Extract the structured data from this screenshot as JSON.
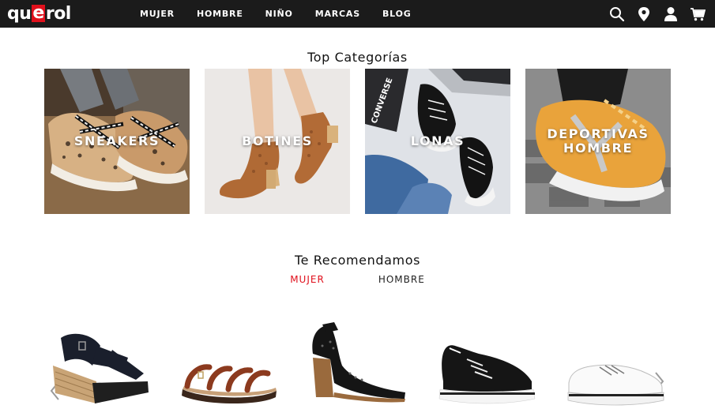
{
  "brand": {
    "logo_left": "qu",
    "logo_mid": "e",
    "logo_right": "rol",
    "accent": "#e0101c"
  },
  "nav": {
    "items": [
      "MUJER",
      "HOMBRE",
      "NIÑO",
      "MARCAS",
      "BLOG"
    ]
  },
  "header_icons": [
    "search-icon",
    "location-pin-icon",
    "user-icon",
    "cart-icon"
  ],
  "top_categories": {
    "title": "Top Categorías",
    "items": [
      {
        "label": "SNEAKERS"
      },
      {
        "label": "BOTINES"
      },
      {
        "label": "LONAS"
      },
      {
        "label": "DEPORTIVAS\nHOMBRE"
      }
    ]
  },
  "recommended": {
    "title": "Te Recomendamos",
    "tabs": [
      {
        "label": "MUJER",
        "active": true
      },
      {
        "label": "HOMBRE",
        "active": false
      }
    ]
  }
}
